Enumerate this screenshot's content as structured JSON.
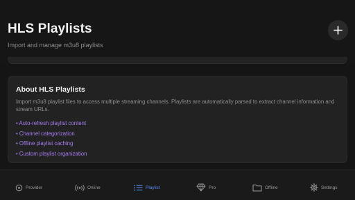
{
  "header": {
    "title": "HLS Playlists",
    "subtitle": "Import and manage m3u8 playlists",
    "add_icon": "plus-icon"
  },
  "about": {
    "title": "About HLS Playlists",
    "description": "Import m3u8 playlist files to access multiple streaming channels. Playlists are automatically parsed to extract channel information and stream URLs.",
    "features": [
      "• Auto-refresh playlist content",
      "• Channel categorization",
      "• Offline playlist caching",
      "• Custom playlist organization"
    ],
    "feature_color": "#a67cf0"
  },
  "nav": {
    "active_color": "#5b8df7",
    "items": [
      {
        "label": "Provider",
        "icon": "provider-icon"
      },
      {
        "label": "Online",
        "icon": "broadcast-icon"
      },
      {
        "label": "Playlist",
        "icon": "list-icon",
        "active": true
      },
      {
        "label": "Pro",
        "icon": "diamond-icon"
      },
      {
        "label": "Offline",
        "icon": "folder-icon"
      },
      {
        "label": "Settings",
        "icon": "gear-icon"
      }
    ]
  }
}
